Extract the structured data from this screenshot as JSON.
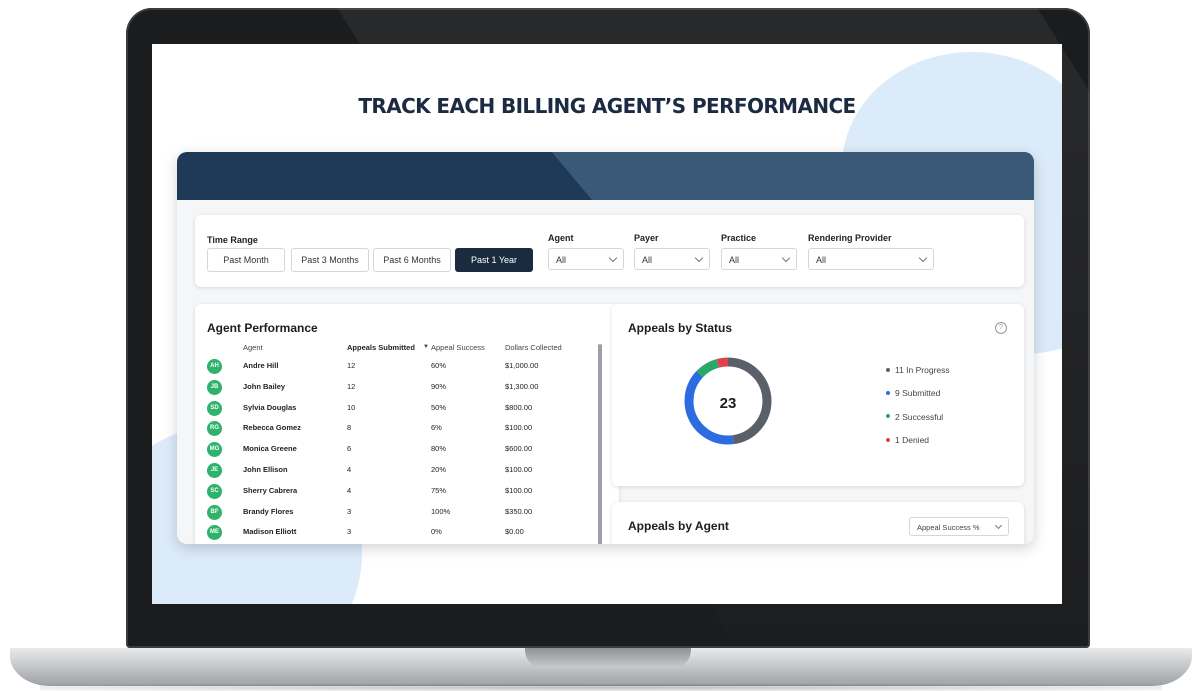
{
  "headline": "TRACK EACH BILLING AGENT’S  PERFORMANCE",
  "filters": {
    "time_range_label": "Time Range",
    "time_buttons": [
      "Past Month",
      "Past 3 Months",
      "Past 6 Months",
      "Past 1 Year"
    ],
    "time_selected": "Past 1 Year",
    "dropdowns": [
      {
        "label": "Agent",
        "value": "All"
      },
      {
        "label": "Payer",
        "value": "All"
      },
      {
        "label": "Practice",
        "value": "All"
      },
      {
        "label": "Rendering Provider",
        "value": "All"
      }
    ]
  },
  "agent_performance": {
    "title": "Agent Performance",
    "columns": [
      "Agent",
      "Appeals Submitted",
      "Appeal Success",
      "Dollars Collected"
    ],
    "sort_indicator": "▼",
    "rows": [
      {
        "initials": "AH",
        "name": "Andre Hill",
        "submitted": "12",
        "success": "60%",
        "dollars": "$1,000.00"
      },
      {
        "initials": "JB",
        "name": "John Bailey",
        "submitted": "12",
        "success": "90%",
        "dollars": "$1,300.00"
      },
      {
        "initials": "SD",
        "name": "Sylvia Douglas",
        "submitted": "10",
        "success": "50%",
        "dollars": "$800.00"
      },
      {
        "initials": "RG",
        "name": "Rebecca Gomez",
        "submitted": "8",
        "success": "6%",
        "dollars": "$100.00"
      },
      {
        "initials": "MG",
        "name": "Monica Greene",
        "submitted": "6",
        "success": "80%",
        "dollars": "$600.00"
      },
      {
        "initials": "JE",
        "name": "John Ellison",
        "submitted": "4",
        "success": "20%",
        "dollars": "$100.00"
      },
      {
        "initials": "SC",
        "name": "Sherry Cabrera",
        "submitted": "4",
        "success": "75%",
        "dollars": "$100.00"
      },
      {
        "initials": "BF",
        "name": "Brandy Flores",
        "submitted": "3",
        "success": "100%",
        "dollars": "$350.00"
      },
      {
        "initials": "ME",
        "name": "Madison Elliott",
        "submitted": "3",
        "success": "0%",
        "dollars": "$0.00"
      }
    ]
  },
  "appeals_by_status": {
    "title": "Appeals by Status",
    "total": "23",
    "help_icon": "question-circle-icon",
    "segments": [
      {
        "label": "11 In Progress",
        "count": 11,
        "color": "#59606a"
      },
      {
        "label": "9 Submitted",
        "count": 9,
        "color": "#2d6be0"
      },
      {
        "label": "2 Successful",
        "count": 2,
        "color": "#2aa86a"
      },
      {
        "label": "1 Denied",
        "count": 1,
        "color": "#e0414b"
      }
    ]
  },
  "appeals_by_agent": {
    "title": "Appeals by Agent",
    "select_value": "Appeal Success %"
  },
  "colors": {
    "header": "#1f3a57",
    "active_button": "#1a2b40",
    "avatar": "#2fb26a",
    "background_blob": "#dcebfa"
  }
}
